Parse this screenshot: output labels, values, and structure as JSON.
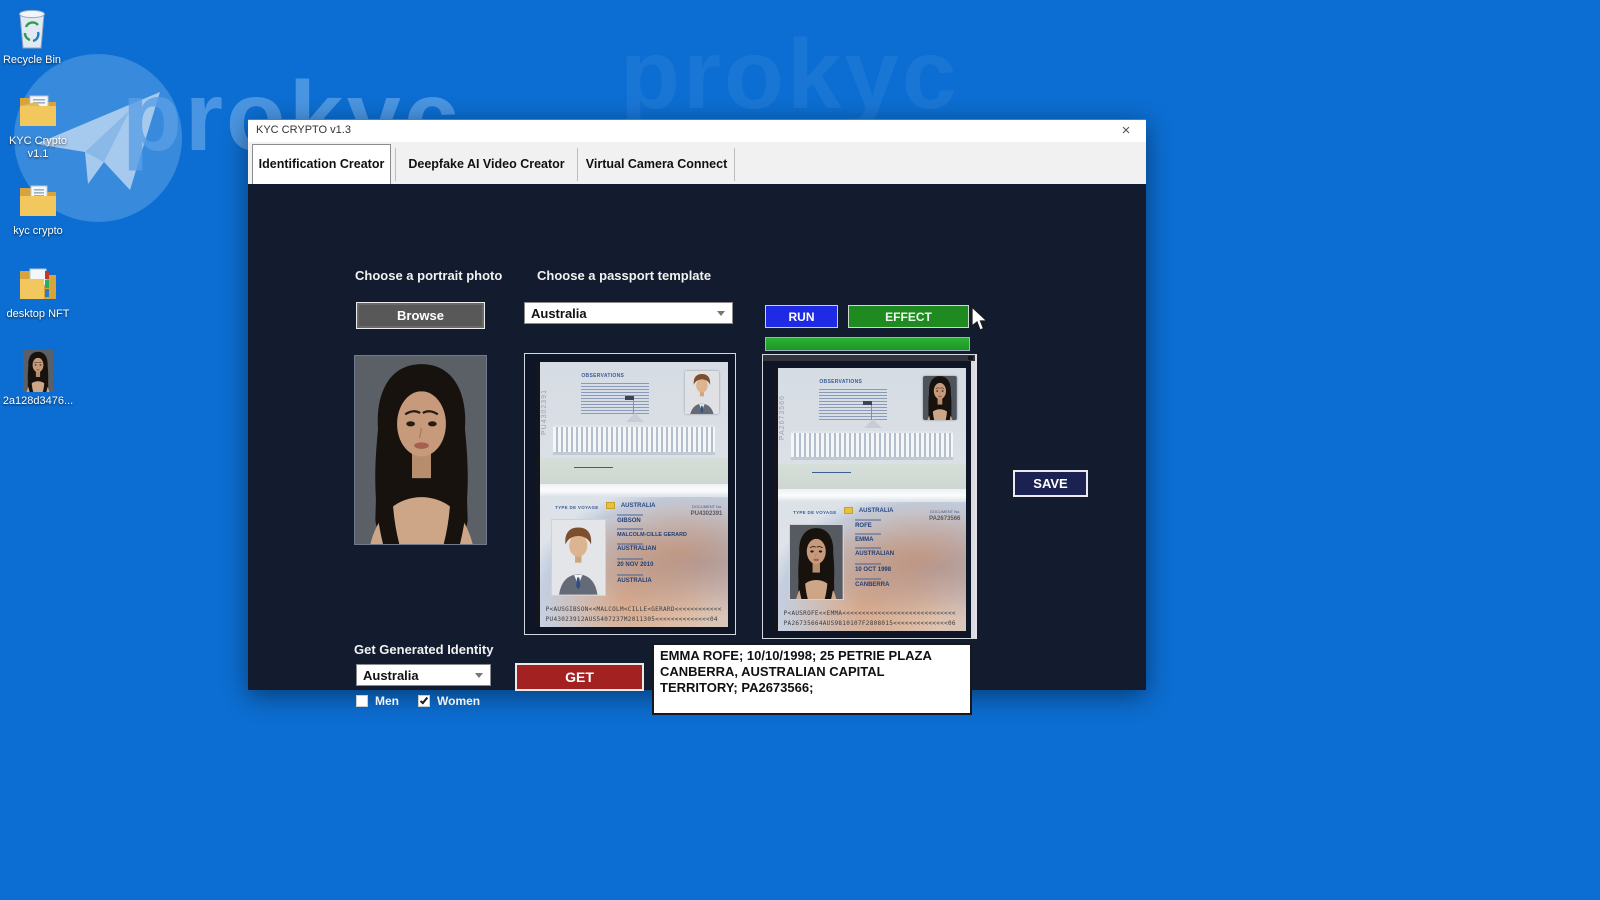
{
  "desktop": {
    "background_color": "#0c6ed2",
    "watermark": {
      "text": "prokyc",
      "accent_color": "#5a9fe6"
    },
    "icons": [
      {
        "name": "recycle-bin",
        "label": "Recycle Bin"
      },
      {
        "name": "kyc-crypto-v11",
        "label": "KYC Crypto v1.1"
      },
      {
        "name": "kyc-crypto",
        "label": "kyc crypto"
      },
      {
        "name": "desktop-nft",
        "label": "desktop NFT"
      },
      {
        "name": "photo-file",
        "label": "2a128d3476..."
      }
    ]
  },
  "window": {
    "title": "KYC CRYPTO v1.3",
    "close_label": "×",
    "tabs": [
      {
        "label": "Identification Creator",
        "active": true
      },
      {
        "label": "Deepfake AI Video Creator",
        "active": false
      },
      {
        "label": "Virtual Camera Connect",
        "active": false
      }
    ],
    "identification": {
      "portrait_label": "Choose a portrait photo",
      "template_label": "Choose a passport template",
      "browse_button": "Browse",
      "template_value": "Australia",
      "run_button": "RUN",
      "effect_button": "EFFECT",
      "progress_percent": 100,
      "progress_color": "#27a32b",
      "save_button": "SAVE",
      "run_color": "#1e2ae4",
      "effect_color": "#1f8a20",
      "get_color": "#a32121",
      "passports": [
        {
          "header": "OBSERVATIONS",
          "doc_number": "PU4302391",
          "type_label": "TYPE DE VOYAGE",
          "country": "AUSTRALIA",
          "doc_label": "DOCUMENT No.",
          "data_lines": [
            "GIBSON",
            "MALCOLM-CILLE GERARD",
            "AUSTRALIAN",
            "20 NOV 2010",
            "AUSTRALIA"
          ],
          "mrz1": "P<AUSGIBSON<<MALCOLM<CILLE<GERARD<<<<<<<<<<<<",
          "mrz2": "PU43023912AUS5407237M2011305<<<<<<<<<<<<<<04"
        },
        {
          "header": "OBSERVATIONS",
          "doc_number": "PA2673566",
          "type_label": "TYPE DE VOYAGE",
          "country": "AUSTRALIA",
          "doc_label": "DOCUMENT No.",
          "data_lines": [
            "ROFE",
            "EMMA",
            "AUSTRALIAN",
            "10 OCT 1998",
            "CANBERRA"
          ],
          "mrz1": "P<AUSROFE<<EMMA<<<<<<<<<<<<<<<<<<<<<<<<<<<<<",
          "mrz2": "PA26735664AUS9810107F2808015<<<<<<<<<<<<<<06"
        }
      ],
      "generated": {
        "label": "Get Generated Identity",
        "country_value": "Australia",
        "get_button": "GET",
        "men_label": "Men",
        "men_checked": false,
        "women_label": "Women",
        "women_checked": true,
        "output_text": "EMMA ROFE; 10/10/1998; 25 PETRIE PLAZA CANBERRA, AUSTRALIAN CAPITAL TERRITORY; PA2673566;"
      }
    }
  }
}
